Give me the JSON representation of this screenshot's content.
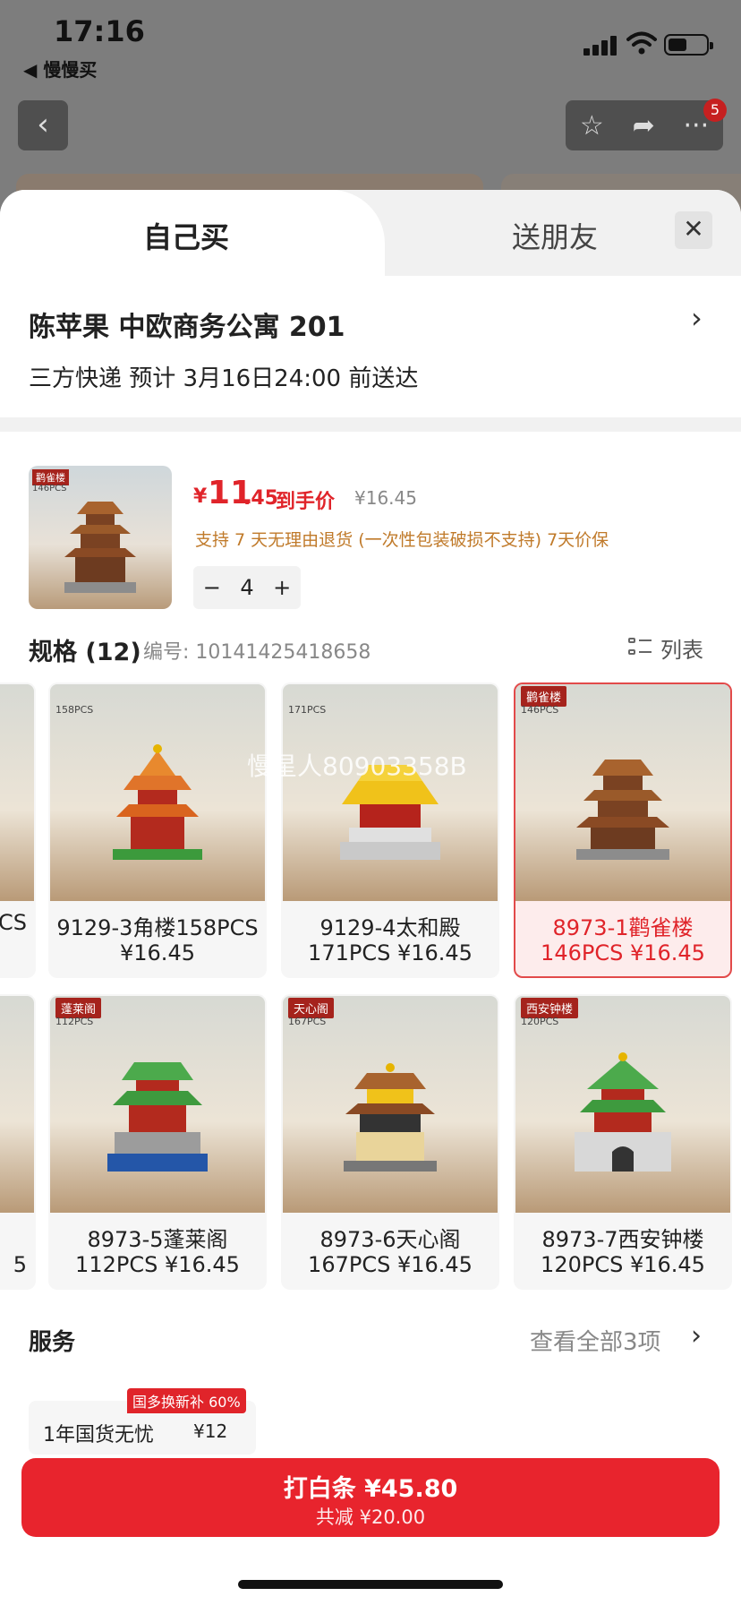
{
  "status_bar": {
    "time": "17:16",
    "back_app": "◀ 慢慢买"
  },
  "nav": {
    "badge_count": "5"
  },
  "tabs": {
    "self_buy": "自己买",
    "gift": "送朋友"
  },
  "address": {
    "line": "陈苹果  中欧商务公寓 201",
    "delivery": "三方快递 预计 3月16日24:00 前送达"
  },
  "product": {
    "thumb_tag": "鹳雀楼",
    "thumb_pcs": "146PCS",
    "currency": "¥",
    "price_int": "11",
    "price_dec": ".45",
    "price_label": "到手价",
    "original_price": "¥16.45",
    "policy": "支持 7 天无理由退货 (一次性包装破损不支持)   7天价保",
    "quantity": "4"
  },
  "spec": {
    "title": "规格 (12)",
    "code": "编号:  10141425418658",
    "list_label": "列表"
  },
  "watermark": "慢星人80903358B",
  "variants": [
    {
      "tag": "",
      "pcs": "158PCS",
      "line1": "9129-3角楼158PCS",
      "line2": "¥16.45",
      "selected": false
    },
    {
      "tag": "",
      "pcs": "171PCS",
      "line1": "9129-4太和殿",
      "line2": "171PCS  ¥16.45",
      "selected": false
    },
    {
      "tag": "鹳雀楼",
      "pcs": "146PCS",
      "line1": "8973-1鹳雀楼",
      "line2": "146PCS  ¥16.45",
      "selected": true
    },
    {
      "tag": "蓬莱阁",
      "pcs": "112PCS",
      "line1": "8973-5蓬莱阁",
      "line2": "112PCS  ¥16.45",
      "selected": false
    },
    {
      "tag": "天心阁",
      "pcs": "167PCS",
      "line1": "8973-6天心阁",
      "line2": "167PCS  ¥16.45",
      "selected": false
    },
    {
      "tag": "西安钟楼",
      "pcs": "120PCS",
      "line1": "8973-7西安钟楼",
      "line2": "120PCS  ¥16.45",
      "selected": false
    }
  ],
  "partial_cards": [
    {
      "line1": "CS",
      "line2": ""
    },
    {
      "line1": "5",
      "line2": ""
    }
  ],
  "service": {
    "title": "服务",
    "view_all": "查看全部3项",
    "badge": "国多换新补 60%",
    "item_name": "1年国货无忧",
    "item_price": "¥12"
  },
  "buy_button": {
    "main": "打白条 ¥45.80",
    "sub": "共减 ¥20.00"
  },
  "colors": {
    "accent": "#e8242d",
    "price": "#e0242a",
    "policy": "#c07a2a"
  }
}
